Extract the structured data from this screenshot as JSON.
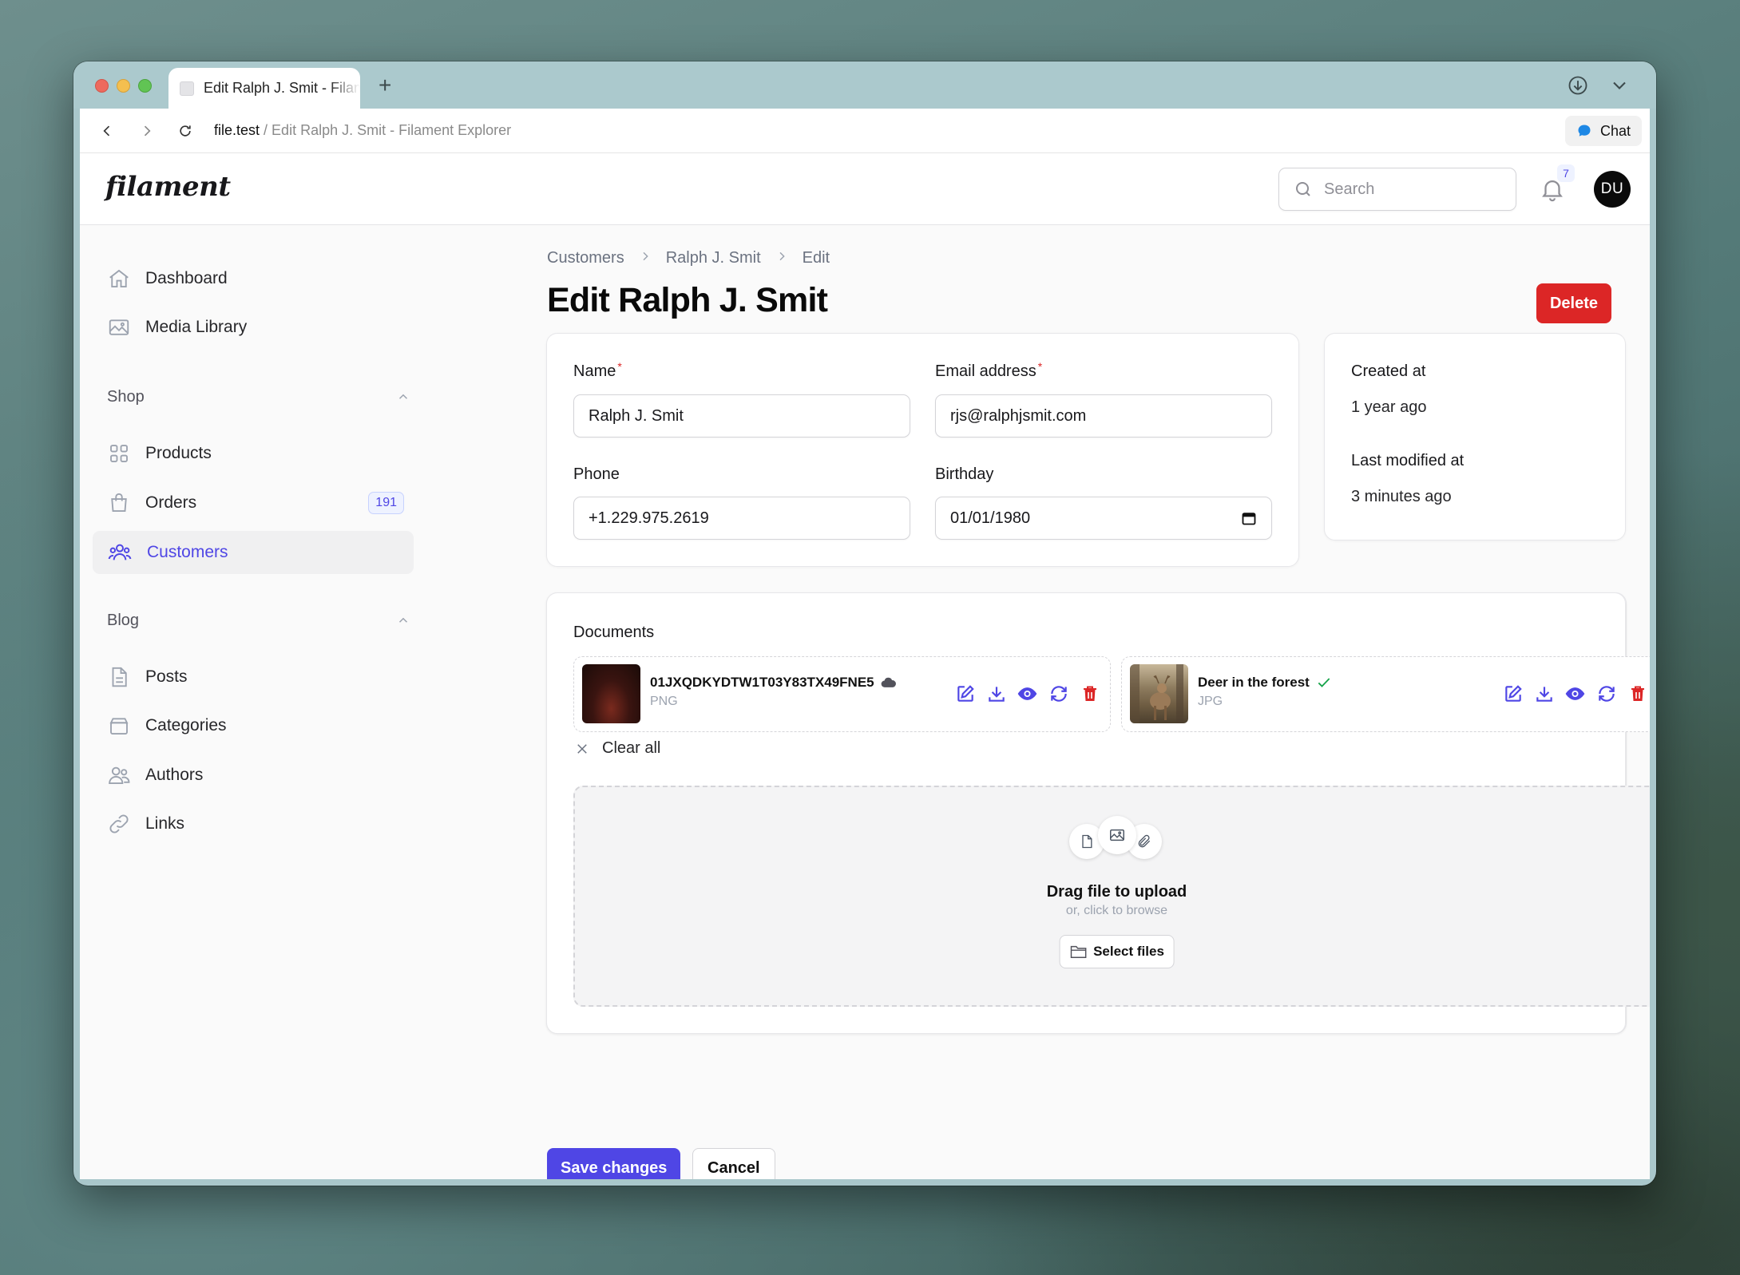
{
  "browser": {
    "tab_title": "Edit Ralph J. Smit - Filament Explorer",
    "url_host": "file.test",
    "url_separator": " / ",
    "url_title": "Edit Ralph J. Smit - Filament Explorer",
    "chat_label": "Chat"
  },
  "app": {
    "logo": "filament",
    "search_placeholder": "Search",
    "notifications_count": "7",
    "user_initials": "DU"
  },
  "sidebar": {
    "items": [
      {
        "label": "Dashboard",
        "icon": "home-icon"
      },
      {
        "label": "Media Library",
        "icon": "image-icon"
      }
    ],
    "groups": [
      {
        "label": "Shop",
        "items": [
          {
            "label": "Products",
            "icon": "squares-icon"
          },
          {
            "label": "Orders",
            "icon": "shopping-bag-icon",
            "badge": "191"
          },
          {
            "label": "Customers",
            "icon": "users-icon",
            "active": true
          }
        ]
      },
      {
        "label": "Blog",
        "items": [
          {
            "label": "Posts",
            "icon": "document-icon"
          },
          {
            "label": "Categories",
            "icon": "archive-icon"
          },
          {
            "label": "Authors",
            "icon": "user-group-icon"
          },
          {
            "label": "Links",
            "icon": "link-icon"
          }
        ]
      }
    ]
  },
  "breadcrumbs": [
    "Customers",
    "Ralph J. Smit",
    "Edit"
  ],
  "page_title": "Edit Ralph J. Smit",
  "delete_label": "Delete",
  "form": {
    "name_label": "Name",
    "name_value": "Ralph J. Smit",
    "email_label": "Email address",
    "email_value": "rjs@ralphjsmit.com",
    "phone_label": "Phone",
    "phone_value": "+1.229.975.2619",
    "birthday_label": "Birthday",
    "birthday_value": "01/01/1980",
    "required_mark": "*"
  },
  "meta": {
    "created_label": "Created at",
    "created_value": "1 year ago",
    "modified_label": "Last modified at",
    "modified_value": "3 minutes ago"
  },
  "documents": {
    "label": "Documents",
    "files": [
      {
        "name": "01JXQDKYDTW1T03Y83TX49FNE5",
        "type": "PNG",
        "status_icon": "cloud-icon"
      },
      {
        "name": "Deer in the forest",
        "type": "JPG",
        "status_icon": "check-icon"
      }
    ],
    "clear_all": "Clear all",
    "dropzone_title": "Drag file to upload",
    "dropzone_sub": "or, click to browse",
    "select_files": "Select files"
  },
  "actions": {
    "save": "Save changes",
    "cancel": "Cancel"
  },
  "colors": {
    "primary": "#4f46e5",
    "danger": "#dc2626",
    "success": "#16a34a"
  }
}
